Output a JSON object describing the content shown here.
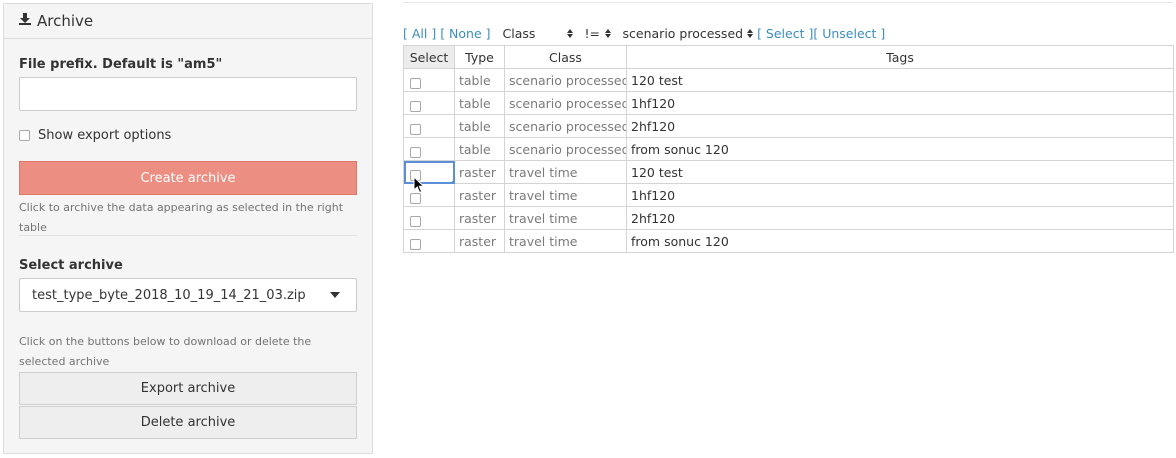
{
  "panel": {
    "title": "Archive",
    "prefix_label": "File prefix. Default is \"am5\"",
    "prefix_value": "",
    "show_export_label": "Show export options",
    "create_button": "Create archive",
    "create_help": "Click to archive the data appearing as selected in the right table",
    "select_label": "Select archive",
    "selected_archive": "test_type_byte_2018_10_19_14_21_03.zip",
    "archive_help": "Click on the buttons below to download or delete the selected archive",
    "export_button": "Export archive",
    "delete_button": "Delete archive"
  },
  "toolbar": {
    "all": "[ All ]",
    "none": "[ None ]",
    "field": "Class",
    "operator": "!=",
    "value": "scenario processed",
    "select": "[ Select ]",
    "unselect": "[ Unselect ]"
  },
  "table": {
    "headers": [
      "Select",
      "Type",
      "Class",
      "Tags"
    ],
    "rows": [
      {
        "type": "table",
        "class": "scenario processed",
        "tags": "120 test"
      },
      {
        "type": "table",
        "class": "scenario processed",
        "tags": "1hf120"
      },
      {
        "type": "table",
        "class": "scenario processed",
        "tags": "2hf120"
      },
      {
        "type": "table",
        "class": "scenario processed",
        "tags": "from sonuc 120"
      },
      {
        "type": "raster",
        "class": "travel time",
        "tags": "120 test"
      },
      {
        "type": "raster",
        "class": "travel time",
        "tags": "1hf120"
      },
      {
        "type": "raster",
        "class": "travel time",
        "tags": "2hf120"
      },
      {
        "type": "raster",
        "class": "travel time",
        "tags": "from sonuc 120"
      }
    ]
  },
  "colors": {
    "accent_link": "#3c8dbc",
    "create_button_bg": "#ec8f82",
    "focus_outline": "#5b8fd8"
  },
  "icons": {
    "panel_header": "download-icon",
    "cursor": "mouse-pointer-icon"
  }
}
